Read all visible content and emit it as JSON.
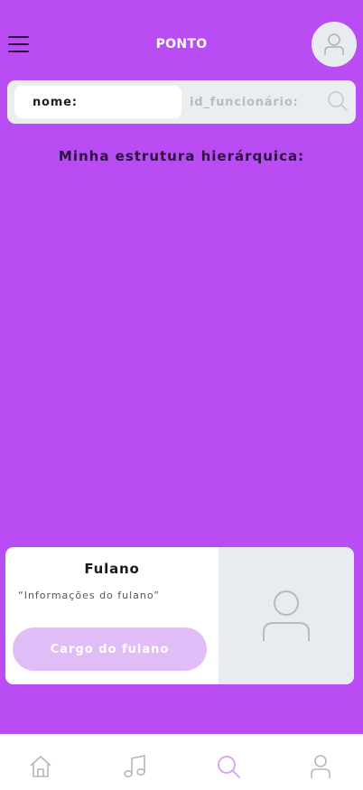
{
  "header": {
    "title": "PONTO",
    "menu_icon": "hamburger-icon",
    "avatar_icon": "user-icon"
  },
  "search": {
    "name_label": "nome:",
    "id_label": "id_funcionário:",
    "search_icon": "search-icon"
  },
  "section": {
    "title": "Minha estrutura hierárquica:"
  },
  "employee_card": {
    "name": "Fulano",
    "info": "“Informações do fulano”",
    "role": "Cargo do fulano",
    "photo_icon": "user-icon"
  },
  "bottom_nav": {
    "items": [
      {
        "icon": "home-icon",
        "active": false
      },
      {
        "icon": "music-icon",
        "active": false
      },
      {
        "icon": "search-icon",
        "active": true
      },
      {
        "icon": "user-icon",
        "active": false
      }
    ]
  },
  "colors": {
    "background": "#b94cf3",
    "accent_light": "#e0bdf7",
    "nav_active": "#d79cf5",
    "nav_inactive": "#b0b8be",
    "dark_text": "#2b1340"
  }
}
